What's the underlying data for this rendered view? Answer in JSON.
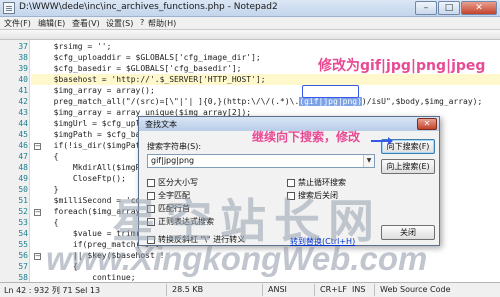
{
  "window": {
    "title": "D:\\WWW\\dede\\inc\\inc_archives_functions.php - Notepad2"
  },
  "menu": [
    "文件(F)",
    "编辑(E)",
    "查看(V)",
    "设置(S)",
    "?",
    "帮助(H)"
  ],
  "editor": {
    "line_numbers": [
      "37",
      "38",
      "39",
      "40",
      "41",
      "42",
      "43",
      "44",
      "45",
      "46",
      "47",
      "48",
      "49",
      "50",
      "51",
      "52",
      "53",
      "54",
      "55",
      "56",
      "57",
      "58"
    ],
    "lines": [
      "  $rsimg = '';",
      "  $cfg_uploaddir = $GLOBALS['cfg_image_dir'];",
      "  $cfg_basedir = $GLOBALS['cfg_basedir'];",
      "  $basehost = 'http://'.$_SERVER['HTTP_HOST'];",
      "  $img_array = array();",
      "  preg_match_all(\"/(src)=[\\\"|'| ]{0,}(http:\\/\\/(.*)\\.",
      "  $img_array = array_unique($img_array[2]);",
      "  $imgUrl = $cfg_uploaddir.\"/\".MyDate($cfg_addon_savetype, time());",
      "  $imgPath = $cfg_basedir.$imgUrl;",
      "  if(!is_dir($imgPath.'/'))",
      "  {",
      "      MkdirAll($imgPath,$G",
      "      CloseFtp();",
      "  }",
      "  $milliSecond = 'co'.d",
      "  foreach($img_array as $",
      "  {",
      "      $value = trim($value",
      "      if(preg_match(\"#\".",
      "      || $key($basehost !",
      "      {",
      "          continue;"
    ],
    "line6_selected": "(gif|jpg|png)",
    "line6_rest": ")/isU\",$body,$img_array);",
    "line19_tail": "{",
    "line8_hidden": "$imgUrl",
    "line22_tail": "$ftype",
    "line23_tail": "$ftype"
  },
  "annotations": {
    "top": "修改为gif|jpg|png|jpeg",
    "dialog": "继续向下搜索，修改"
  },
  "dialog": {
    "title": "查找文本",
    "search_label": "搜索字符串(S):",
    "search_value": "gif|jpg|png",
    "btn_find_next": "向下搜索(F)",
    "btn_find_prev": "向上搜索(E)",
    "btn_close": "关闭",
    "opt_match_case": "区分大小写",
    "opt_whole_word": "全字匹配",
    "opt_wrap": "匹配行首",
    "opt_no_wrap": "禁止循环搜索",
    "opt_regex": "正则表达式搜索",
    "opt_escape": "转换反斜杠 \"\\\" 进行转义",
    "opt_auto_close": "搜索后关闭",
    "link_replace": "转到替换(Ctrl+H)"
  },
  "watermark": {
    "cn": "星空站长网",
    "url": "www.XingkongWeb.com"
  },
  "status": {
    "position": "Ln 42 : 932    列 71    Sel 13",
    "size": "28.5 KB",
    "encoding": "ANSI",
    "eol": "CR+LF",
    "ins": "INS",
    "scheme": "Web Source Code"
  }
}
